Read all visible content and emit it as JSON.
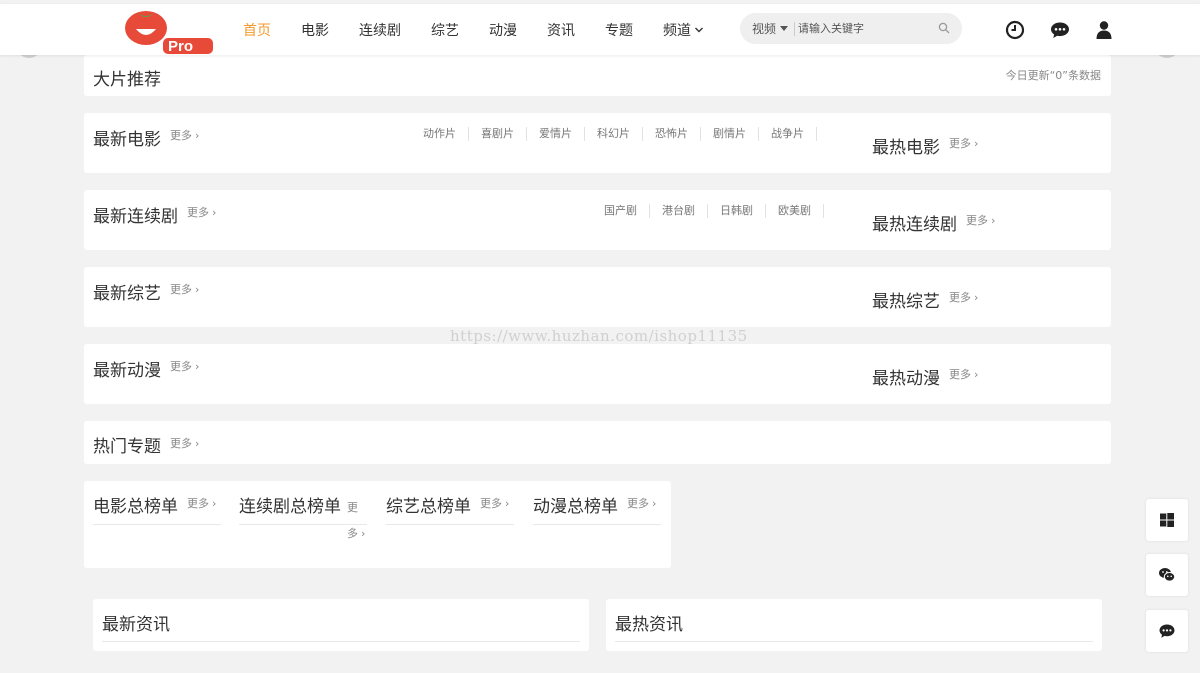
{
  "logo": {
    "badge": "Pro"
  },
  "nav": {
    "items": [
      "首页",
      "电影",
      "连续剧",
      "综艺",
      "动漫",
      "资讯",
      "专题",
      "频道"
    ],
    "active_index": 0
  },
  "search": {
    "type": "视频",
    "placeholder": "请输入关键字"
  },
  "header_icons": [
    "history-icon",
    "message-icon",
    "user-icon"
  ],
  "featured": {
    "title": "大片推荐",
    "update_text": "今日更新“0”条数据"
  },
  "more_label": "更多",
  "sections": {
    "movie": {
      "title": "最新电影",
      "hot_title": "最热电影",
      "categories": [
        "动作片",
        "喜剧片",
        "爱情片",
        "科幻片",
        "恐怖片",
        "剧情片",
        "战争片"
      ]
    },
    "series": {
      "title": "最新连续剧",
      "hot_title": "最热连续剧",
      "categories": [
        "国产剧",
        "港台剧",
        "日韩剧",
        "欧美剧"
      ]
    },
    "variety": {
      "title": "最新综艺",
      "hot_title": "最热综艺"
    },
    "anime": {
      "title": "最新动漫",
      "hot_title": "最热动漫"
    }
  },
  "topics": {
    "title": "热门专题"
  },
  "rankings": [
    "电影总榜单",
    "连续剧总榜单",
    "综艺总榜单",
    "动漫总榜单"
  ],
  "news": {
    "latest": "最新资讯",
    "hot": "最热资讯"
  },
  "watermark": "https://www.huzhan.com/ishop11135",
  "side_buttons": [
    "windows-icon",
    "wechat-icon",
    "chat-icon"
  ],
  "colors": {
    "accent": "#f39a2d",
    "logo_red": "#e84a3a"
  }
}
